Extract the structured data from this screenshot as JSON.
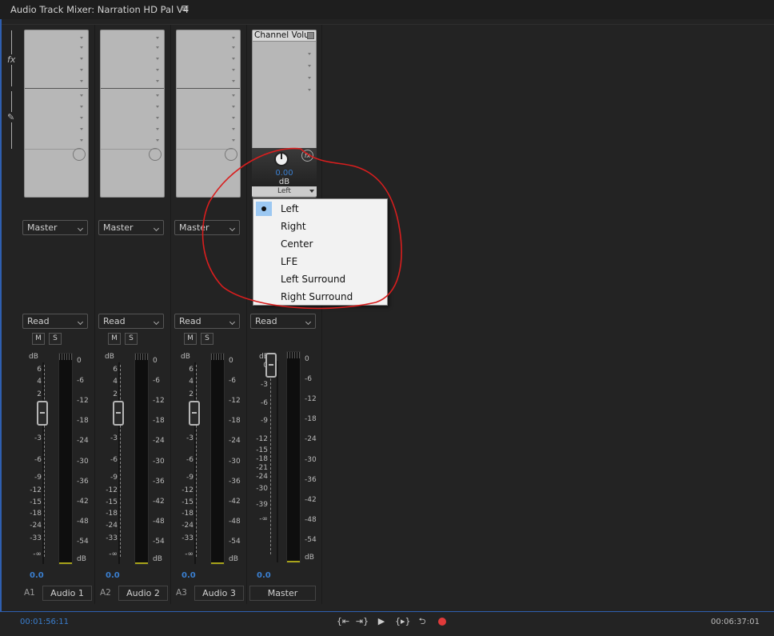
{
  "window": {
    "title": "Audio Track Mixer: Narration HD Pal V4",
    "menu_icon": "hamburger-icon"
  },
  "side_tools": {
    "fx_label": "fx",
    "pen_icon": "automation-pen-icon"
  },
  "tracks": [
    {
      "id": "A1",
      "name": "Audio 1",
      "output": "Master",
      "automation": "Read",
      "mute": "M",
      "solo": "S",
      "volume": "0.0"
    },
    {
      "id": "A2",
      "name": "Audio 2",
      "output": "Master",
      "automation": "Read",
      "mute": "M",
      "solo": "S",
      "volume": "0.0"
    },
    {
      "id": "A3",
      "name": "Audio 3",
      "output": "Master",
      "automation": "Read",
      "mute": "M",
      "solo": "S",
      "volume": "0.0"
    }
  ],
  "master": {
    "name": "Master",
    "effect_header": "Channel Volu",
    "panner_value": "0.00",
    "panner_unit": "dB",
    "panner_channel": "Left",
    "automation": "Read",
    "volume": "0.0"
  },
  "track_scale": {
    "header": "dB",
    "labels": [
      "6",
      "4",
      "2",
      "0",
      "-3",
      "-6",
      "-9",
      "-12",
      "-15",
      "-18",
      "-24",
      "-33",
      "-∞"
    ]
  },
  "master_scale": {
    "header": "dB",
    "labels": [
      "0",
      "-3",
      "-6",
      "-9",
      "-12",
      "-15",
      "-18",
      "-21",
      "-24",
      "-30",
      "-39",
      "-∞"
    ]
  },
  "meter_scale": {
    "labels": [
      "0",
      "-6",
      "-12",
      "-18",
      "-24",
      "-30",
      "-36",
      "-42",
      "-48",
      "-54",
      "dB"
    ]
  },
  "master_meter_scale": {
    "labels": [
      "0",
      "-6",
      "-12",
      "-18",
      "-24",
      "-30",
      "-36",
      "-42",
      "-48",
      "-54",
      "dB"
    ]
  },
  "channel_menu": {
    "selected": "Left",
    "items": [
      "Left",
      "Right",
      "Center",
      "LFE",
      "Left Surround",
      "Right Surround"
    ]
  },
  "transport": {
    "timecode_current": "00:01:56:11",
    "timecode_duration": "00:06:37:01",
    "buttons": [
      "go-to-in-icon",
      "go-to-out-icon",
      "play-icon",
      "play-in-to-out-icon",
      "loop-icon",
      "record-icon"
    ]
  },
  "colors": {
    "accent_blue": "#3a7fd0",
    "record_red": "#e03a3a",
    "annotation_red": "#d81e1e",
    "menu_highlight": "#9cc8f2"
  }
}
